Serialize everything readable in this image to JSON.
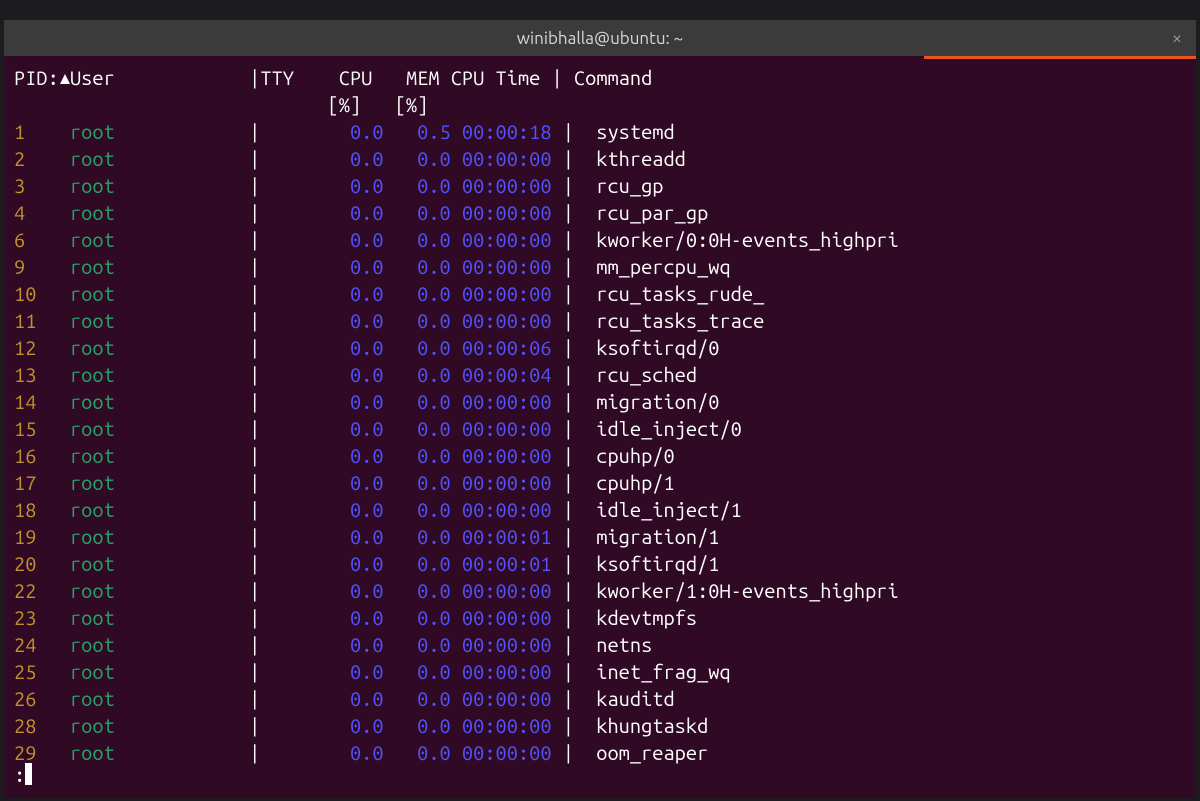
{
  "titlebar": {
    "title": "winibhalla@ubuntu: ~",
    "close_glyph": "×"
  },
  "header": {
    "pid_label": "PID:",
    "user_label": "User",
    "tty_label": "TTY",
    "cpu_label": "CPU",
    "mem_label": "MEM",
    "cpu_time_label": "CPU Time",
    "command_label": "Command",
    "unit_pct": "[%]",
    "separator": "|"
  },
  "status": {
    "prompt": ":"
  },
  "processes": [
    {
      "pid": "1",
      "user": "root",
      "tty": "",
      "cpu": "0.0",
      "mem": "0.5",
      "cpu_time": "00:00:18",
      "command": "systemd"
    },
    {
      "pid": "2",
      "user": "root",
      "tty": "",
      "cpu": "0.0",
      "mem": "0.0",
      "cpu_time": "00:00:00",
      "command": "kthreadd"
    },
    {
      "pid": "3",
      "user": "root",
      "tty": "",
      "cpu": "0.0",
      "mem": "0.0",
      "cpu_time": "00:00:00",
      "command": "rcu_gp"
    },
    {
      "pid": "4",
      "user": "root",
      "tty": "",
      "cpu": "0.0",
      "mem": "0.0",
      "cpu_time": "00:00:00",
      "command": "rcu_par_gp"
    },
    {
      "pid": "6",
      "user": "root",
      "tty": "",
      "cpu": "0.0",
      "mem": "0.0",
      "cpu_time": "00:00:00",
      "command": "kworker/0:0H-events_highpri"
    },
    {
      "pid": "9",
      "user": "root",
      "tty": "",
      "cpu": "0.0",
      "mem": "0.0",
      "cpu_time": "00:00:00",
      "command": "mm_percpu_wq"
    },
    {
      "pid": "10",
      "user": "root",
      "tty": "",
      "cpu": "0.0",
      "mem": "0.0",
      "cpu_time": "00:00:00",
      "command": "rcu_tasks_rude_"
    },
    {
      "pid": "11",
      "user": "root",
      "tty": "",
      "cpu": "0.0",
      "mem": "0.0",
      "cpu_time": "00:00:00",
      "command": "rcu_tasks_trace"
    },
    {
      "pid": "12",
      "user": "root",
      "tty": "",
      "cpu": "0.0",
      "mem": "0.0",
      "cpu_time": "00:00:06",
      "command": "ksoftirqd/0"
    },
    {
      "pid": "13",
      "user": "root",
      "tty": "",
      "cpu": "0.0",
      "mem": "0.0",
      "cpu_time": "00:00:04",
      "command": "rcu_sched"
    },
    {
      "pid": "14",
      "user": "root",
      "tty": "",
      "cpu": "0.0",
      "mem": "0.0",
      "cpu_time": "00:00:00",
      "command": "migration/0"
    },
    {
      "pid": "15",
      "user": "root",
      "tty": "",
      "cpu": "0.0",
      "mem": "0.0",
      "cpu_time": "00:00:00",
      "command": "idle_inject/0"
    },
    {
      "pid": "16",
      "user": "root",
      "tty": "",
      "cpu": "0.0",
      "mem": "0.0",
      "cpu_time": "00:00:00",
      "command": "cpuhp/0"
    },
    {
      "pid": "17",
      "user": "root",
      "tty": "",
      "cpu": "0.0",
      "mem": "0.0",
      "cpu_time": "00:00:00",
      "command": "cpuhp/1"
    },
    {
      "pid": "18",
      "user": "root",
      "tty": "",
      "cpu": "0.0",
      "mem": "0.0",
      "cpu_time": "00:00:00",
      "command": "idle_inject/1"
    },
    {
      "pid": "19",
      "user": "root",
      "tty": "",
      "cpu": "0.0",
      "mem": "0.0",
      "cpu_time": "00:00:01",
      "command": "migration/1"
    },
    {
      "pid": "20",
      "user": "root",
      "tty": "",
      "cpu": "0.0",
      "mem": "0.0",
      "cpu_time": "00:00:01",
      "command": "ksoftirqd/1"
    },
    {
      "pid": "22",
      "user": "root",
      "tty": "",
      "cpu": "0.0",
      "mem": "0.0",
      "cpu_time": "00:00:00",
      "command": "kworker/1:0H-events_highpri"
    },
    {
      "pid": "23",
      "user": "root",
      "tty": "",
      "cpu": "0.0",
      "mem": "0.0",
      "cpu_time": "00:00:00",
      "command": "kdevtmpfs"
    },
    {
      "pid": "24",
      "user": "root",
      "tty": "",
      "cpu": "0.0",
      "mem": "0.0",
      "cpu_time": "00:00:00",
      "command": "netns"
    },
    {
      "pid": "25",
      "user": "root",
      "tty": "",
      "cpu": "0.0",
      "mem": "0.0",
      "cpu_time": "00:00:00",
      "command": "inet_frag_wq"
    },
    {
      "pid": "26",
      "user": "root",
      "tty": "",
      "cpu": "0.0",
      "mem": "0.0",
      "cpu_time": "00:00:00",
      "command": "kauditd"
    },
    {
      "pid": "28",
      "user": "root",
      "tty": "",
      "cpu": "0.0",
      "mem": "0.0",
      "cpu_time": "00:00:00",
      "command": "khungtaskd"
    },
    {
      "pid": "29",
      "user": "root",
      "tty": "",
      "cpu": "0.0",
      "mem": "0.0",
      "cpu_time": "00:00:00",
      "command": "oom_reaper"
    }
  ]
}
